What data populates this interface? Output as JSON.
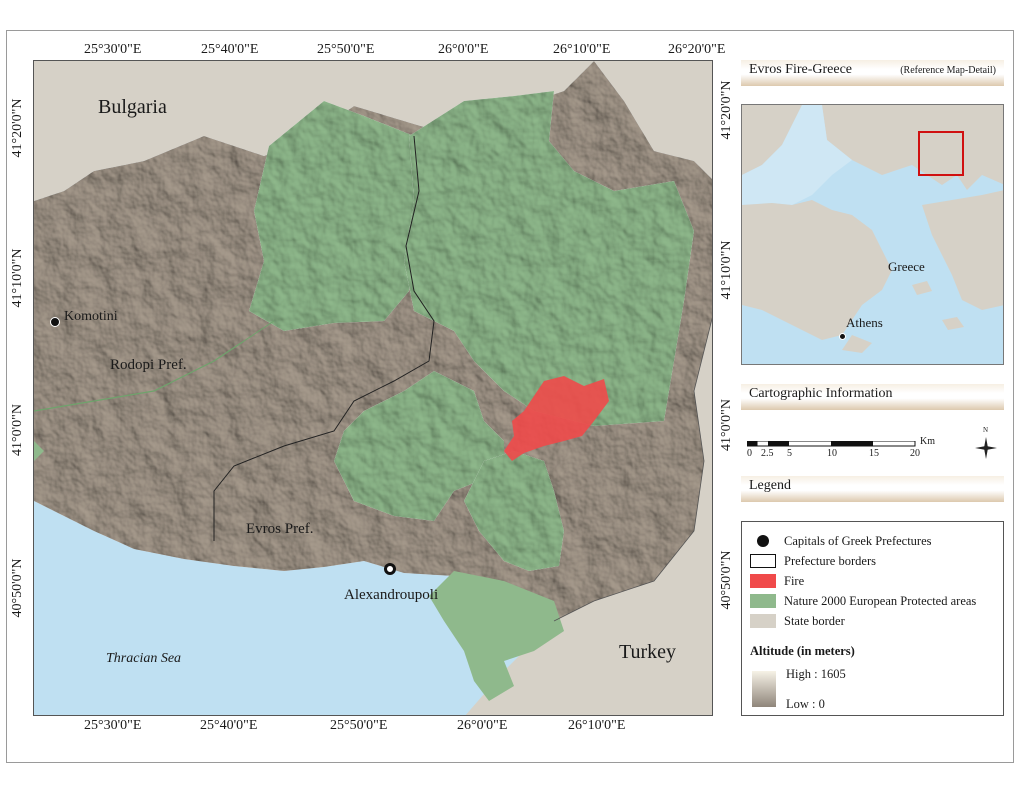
{
  "map": {
    "top_ticks": [
      "25°30'0\"E",
      "25°40'0\"E",
      "25°50'0\"E",
      "26°0'0\"E",
      "26°10'0\"E",
      "26°20'0\"E"
    ],
    "bottom_ticks": [
      "25°30'0\"E",
      "25°40'0\"E",
      "25°50'0\"E",
      "26°0'0\"E",
      "26°10'0\"E"
    ],
    "left_ticks": [
      "41°20'0\"N",
      "41°10'0\"N",
      "41°0'0\"N",
      "40°50'0\"N"
    ],
    "right_ticks": [
      "41°20'0\"N",
      "41°10'0\"N",
      "41°0'0\"N",
      "40°50'0\"N"
    ],
    "labels": {
      "bulgaria": "Bulgaria",
      "komotini": "Komotini",
      "rodopi": "Rodopi Pref.",
      "evros": "Evros Pref.",
      "alexandroupoli": "Alexandroupoli",
      "thracian_sea": "Thracian Sea",
      "turkey": "Turkey"
    },
    "colors": {
      "sea": "#bfe0f2",
      "terrain": "#a89c8e",
      "protected": "#8fb98c",
      "fire": "#f04a4a",
      "state": "#d6d1c7"
    }
  },
  "reference": {
    "title": "Evros Fire-Greece",
    "subtitle": "(Reference Map-Detail)",
    "greece": "Greece",
    "athens": "Athens"
  },
  "cartographic": {
    "title": "Cartographic Information",
    "unit": "Km",
    "scale_labels": [
      "0",
      "2.5",
      "5",
      "10",
      "15",
      "20"
    ],
    "north_label": "N"
  },
  "legend": {
    "title": "Legend",
    "items": [
      {
        "label": "Capitals of Greek Prefectures",
        "kind": "dot"
      },
      {
        "label": "Prefecture borders",
        "kind": "outline"
      },
      {
        "label": "Fire",
        "kind": "fire"
      },
      {
        "label": "Nature 2000 European Protected areas",
        "kind": "protected"
      },
      {
        "label": "State border",
        "kind": "state"
      }
    ],
    "altitude_title": "Altitude (in meters)",
    "high": "High : 1605",
    "low": "Low : 0"
  }
}
